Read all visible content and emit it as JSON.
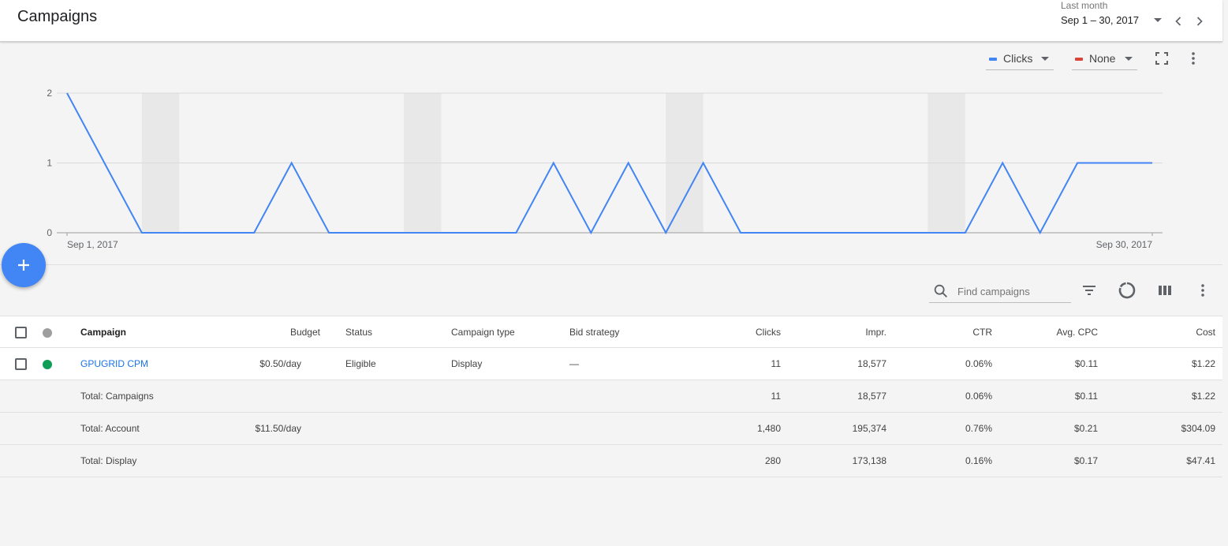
{
  "header": {
    "title": "Campaigns",
    "date_label": "Last month",
    "date_value": "Sep 1 – 30, 2017"
  },
  "chart_controls": {
    "metric1": {
      "label": "Clicks",
      "color": "#4285f4"
    },
    "metric2": {
      "label": "None",
      "color": "#db4437"
    }
  },
  "chart_data": {
    "type": "line",
    "series": [
      {
        "name": "Clicks",
        "color": "#4285f4",
        "values": [
          2,
          1,
          0,
          0,
          0,
          0,
          1,
          0,
          0,
          0,
          0,
          0,
          0,
          1,
          0,
          1,
          0,
          1,
          0,
          0,
          0,
          0,
          0,
          0,
          0,
          1,
          0,
          1,
          1,
          1
        ]
      }
    ],
    "x_start_label": "Sep 1, 2017",
    "x_end_label": "Sep 30, 2017",
    "y_ticks": [
      0,
      1,
      2
    ],
    "ylim": [
      0,
      2
    ],
    "weekend_bands": [
      [
        2,
        3
      ],
      [
        9,
        10
      ],
      [
        16,
        17
      ],
      [
        23,
        24
      ]
    ],
    "grid": true
  },
  "toolbar": {
    "search_placeholder": "Find campaigns"
  },
  "table": {
    "columns": {
      "campaign": "Campaign",
      "budget": "Budget",
      "status": "Status",
      "type": "Campaign type",
      "bid": "Bid strategy",
      "clicks": "Clicks",
      "impr": "Impr.",
      "ctr": "CTR",
      "cpc": "Avg. CPC",
      "cost": "Cost"
    },
    "rows": [
      {
        "campaign": "GPUGRID CPM",
        "budget": "$0.50/day",
        "status": "Eligible",
        "type": "Display",
        "bid": "—",
        "clicks": "11",
        "impr": "18,577",
        "ctr": "0.06%",
        "cpc": "$0.11",
        "cost": "$1.22",
        "status_color": "#0f9d58"
      }
    ],
    "totals": [
      {
        "label": "Total: Campaigns",
        "budget": "",
        "clicks": "11",
        "impr": "18,577",
        "ctr": "0.06%",
        "cpc": "$0.11",
        "cost": "$1.22"
      },
      {
        "label": "Total: Account",
        "budget": "$11.50/day",
        "clicks": "1,480",
        "impr": "195,374",
        "ctr": "0.76%",
        "cpc": "$0.21",
        "cost": "$304.09"
      },
      {
        "label": "Total: Display",
        "budget": "",
        "clicks": "280",
        "impr": "173,138",
        "ctr": "0.16%",
        "cpc": "$0.17",
        "cost": "$47.41"
      }
    ]
  }
}
